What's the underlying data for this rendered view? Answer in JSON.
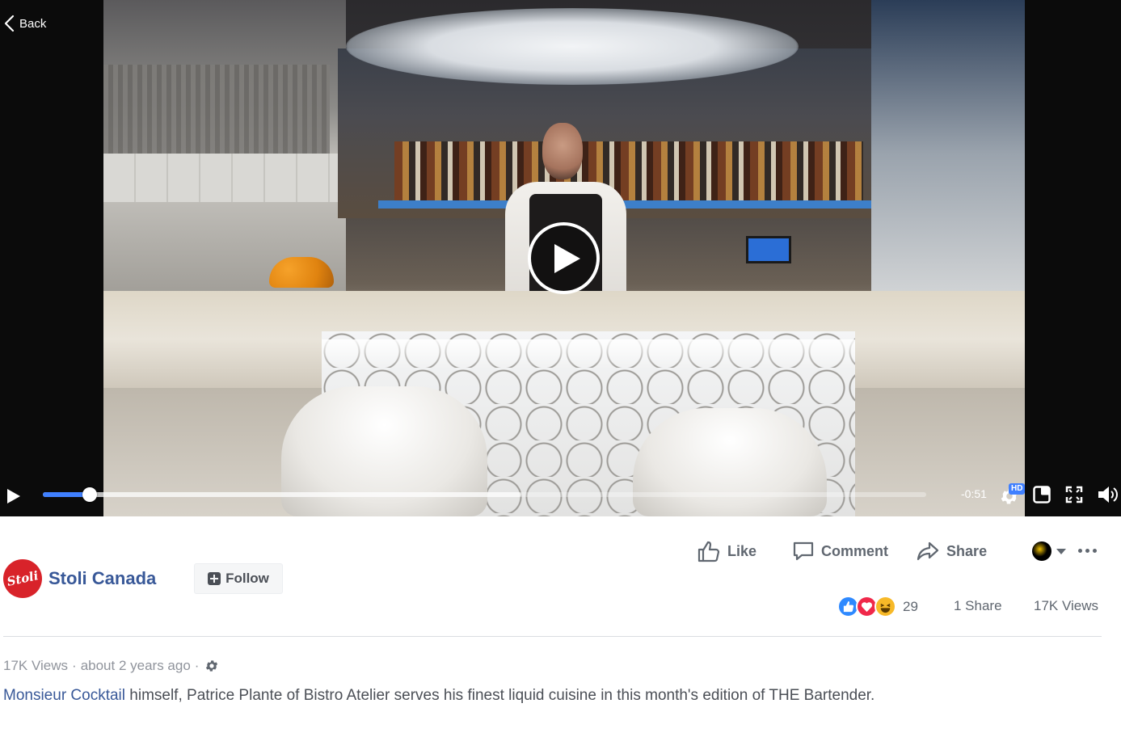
{
  "video": {
    "back_label": "Back",
    "time_remaining": "-0:51",
    "quality_badge": "HD",
    "progress_played_percent": 5.3,
    "progress_buffered_percent": 54.2
  },
  "actions": {
    "like_label": "Like",
    "comment_label": "Comment",
    "share_label": "Share"
  },
  "page": {
    "name": "Stoli Canada",
    "logo_text": "Stoli",
    "follow_label": "Follow"
  },
  "stats": {
    "reaction_count": "29",
    "share_count": "1 Share",
    "views": "17K Views"
  },
  "meta": {
    "views": "17K Views",
    "separator": "·",
    "posted": "about 2 years ago"
  },
  "description": {
    "link_text": "Monsieur Cocktail",
    "text": " himself, Patrice Plante of Bistro Atelier serves his finest liquid cuisine in this month's edition of THE Bartender."
  },
  "colors": {
    "link": "#385898",
    "progress": "#4080ff",
    "like_reaction": "#2e89ff",
    "love_reaction": "#f0284a",
    "haha_reaction": "#f7b928",
    "logo_red": "#d8232a"
  },
  "icons": {
    "back": "chevron-left-icon",
    "play": "play-icon",
    "settings": "gear-icon",
    "pip": "picture-in-picture-icon",
    "fullscreen": "fullscreen-icon",
    "volume": "volume-icon",
    "like": "thumbs-up-icon",
    "comment": "comment-bubble-icon",
    "share": "share-arrow-icon",
    "more": "more-dots-icon"
  }
}
